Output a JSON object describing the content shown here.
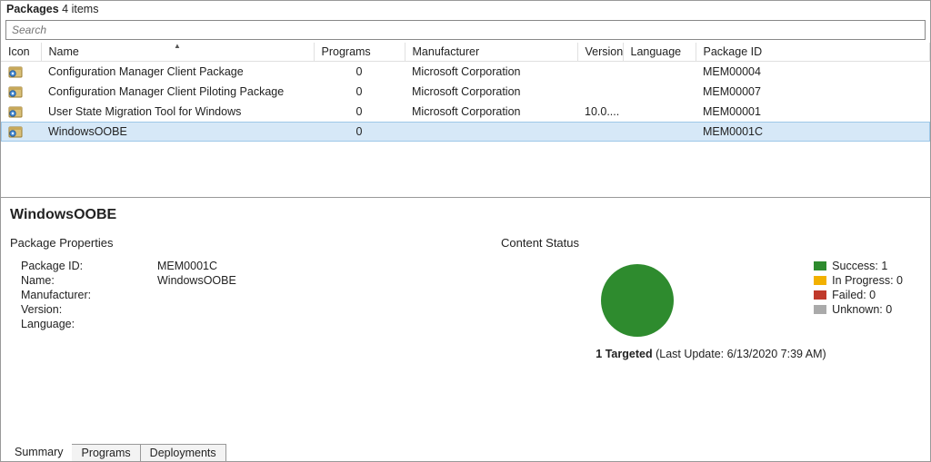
{
  "header": {
    "title": "Packages",
    "count_label": "4 items"
  },
  "search": {
    "placeholder": "Search"
  },
  "columns": {
    "icon": "Icon",
    "name": "Name",
    "programs": "Programs",
    "manufacturer": "Manufacturer",
    "version": "Version",
    "language": "Language",
    "package_id": "Package ID"
  },
  "rows": [
    {
      "name": "Configuration Manager Client Package",
      "programs": "0",
      "manufacturer": "Microsoft Corporation",
      "version": "",
      "language": "",
      "package_id": "MEM00004",
      "selected": false
    },
    {
      "name": "Configuration Manager Client Piloting Package",
      "programs": "0",
      "manufacturer": "Microsoft Corporation",
      "version": "",
      "language": "",
      "package_id": "MEM00007",
      "selected": false
    },
    {
      "name": "User State Migration Tool for Windows",
      "programs": "0",
      "manufacturer": "Microsoft Corporation",
      "version": "10.0....",
      "language": "",
      "package_id": "MEM00001",
      "selected": false
    },
    {
      "name": "WindowsOOBE",
      "programs": "0",
      "manufacturer": "",
      "version": "",
      "language": "",
      "package_id": "MEM0001C",
      "selected": true
    }
  ],
  "detail": {
    "title": "WindowsOOBE",
    "properties_heading": "Package Properties",
    "props": {
      "package_id_label": "Package ID:",
      "package_id": "MEM0001C",
      "name_label": "Name:",
      "name": "WindowsOOBE",
      "manufacturer_label": "Manufacturer:",
      "manufacturer": "",
      "version_label": "Version:",
      "version": "",
      "language_label": "Language:",
      "language": ""
    },
    "content_status_heading": "Content Status",
    "status": {
      "success_label": "Success: 1",
      "inprogress_label": "In Progress: 0",
      "failed_label": "Failed: 0",
      "unknown_label": "Unknown: 0",
      "targeted_count": "1 Targeted",
      "targeted_update": "(Last Update: 6/13/2020 7:39 AM)"
    }
  },
  "tabs": {
    "summary": "Summary",
    "programs": "Programs",
    "deployments": "Deployments"
  },
  "chart_data": {
    "type": "pie",
    "title": "Content Status",
    "series": [
      {
        "name": "Success",
        "value": 1,
        "color": "#2e8b2e"
      },
      {
        "name": "In Progress",
        "value": 0,
        "color": "#f2b100"
      },
      {
        "name": "Failed",
        "value": 0,
        "color": "#c0392b"
      },
      {
        "name": "Unknown",
        "value": 0,
        "color": "#aaaaaa"
      }
    ]
  }
}
